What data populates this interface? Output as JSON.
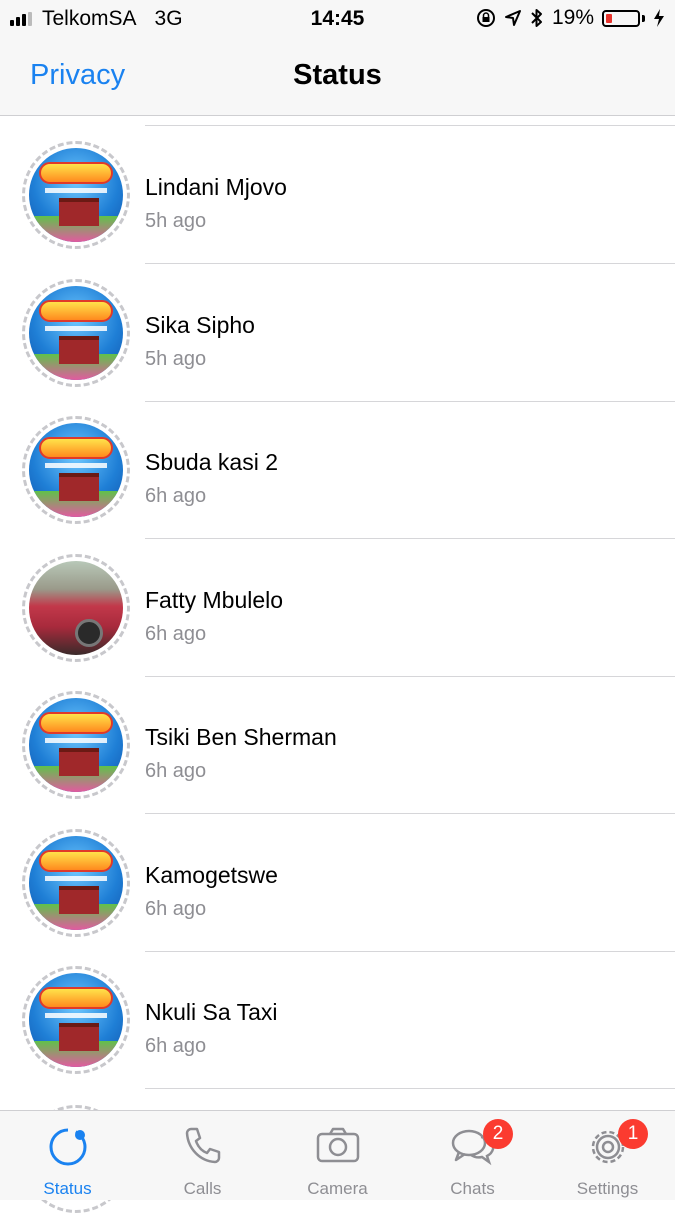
{
  "status_bar": {
    "carrier": "TelkomSA",
    "network": "3G",
    "time": "14:45",
    "battery": "19%",
    "battery_level": 0.19
  },
  "nav": {
    "back_label": "Privacy",
    "title": "Status"
  },
  "statuses": [
    {
      "name": "Lindani Mjovo",
      "time": "5h ago"
    },
    {
      "name": "Sika Sipho",
      "time": "5h ago"
    },
    {
      "name": "Sbuda kasi 2",
      "time": "6h ago"
    },
    {
      "name": "Fatty Mbulelo",
      "time": "6h ago"
    },
    {
      "name": "Tsiki Ben Sherman",
      "time": "6h ago"
    },
    {
      "name": "Kamogetswe",
      "time": "6h ago"
    },
    {
      "name": "Nkuli Sa Taxi",
      "time": "6h ago"
    }
  ],
  "tabs": [
    {
      "label": "Status",
      "icon": "status-icon",
      "active": true
    },
    {
      "label": "Calls",
      "icon": "phone-icon"
    },
    {
      "label": "Camera",
      "icon": "camera-icon"
    },
    {
      "label": "Chats",
      "icon": "chat-bubbles-icon",
      "badge": "2"
    },
    {
      "label": "Settings",
      "icon": "gear-icon",
      "badge": "1"
    }
  ],
  "colors": {
    "accent": "#1a82f0",
    "badge": "#fb3b30",
    "battery_low": "#e8332c"
  }
}
